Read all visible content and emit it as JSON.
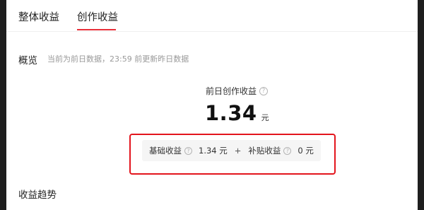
{
  "tabs": [
    {
      "label": "整体收益",
      "active": false
    },
    {
      "label": "创作收益",
      "active": true
    }
  ],
  "overview": {
    "title": "概览",
    "note": "当前为前日数据，23:59 前更新昨日数据"
  },
  "metric": {
    "label": "前日创作收益",
    "value": "1.34",
    "unit": "元",
    "help_icon": "question-circle-icon"
  },
  "breakdown": {
    "base_label": "基础收益",
    "base_value": "1.34 元",
    "plus": "+",
    "subsidy_label": "补贴收益",
    "subsidy_value": "0 元"
  },
  "trend": {
    "title": "收益趋势"
  },
  "colors": {
    "accent": "#e8303a",
    "highlight_border": "#e3151d",
    "muted_text": "#9a9a9a",
    "breakdown_bg": "#f5f5f5"
  },
  "help_glyph": "?"
}
